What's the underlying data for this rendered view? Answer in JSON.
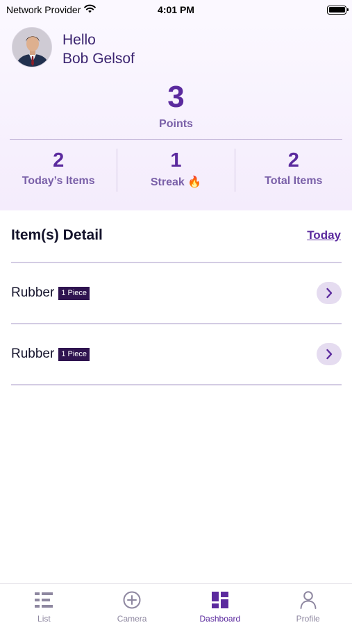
{
  "status_bar": {
    "carrier": "Network Provider",
    "time": "4:01 PM"
  },
  "header": {
    "greeting": "Hello",
    "user_name": "Bob Gelsof",
    "points_value": "3",
    "points_label": "Points",
    "stats": [
      {
        "value": "2",
        "label": "Today’s Items"
      },
      {
        "value": "1",
        "label": "Streak 🔥"
      },
      {
        "value": "2",
        "label": "Total Items"
      }
    ]
  },
  "detail": {
    "title": "Item(s) Detail",
    "filter_link": "Today",
    "items": [
      {
        "name": "Rubber",
        "badge": "1 Piece"
      },
      {
        "name": "Rubber",
        "badge": "1 Piece"
      }
    ]
  },
  "tab_bar": {
    "tabs": [
      {
        "label": "List",
        "icon": "list-icon"
      },
      {
        "label": "Camera",
        "icon": "add-circle-icon"
      },
      {
        "label": "Dashboard",
        "icon": "dashboard-icon"
      },
      {
        "label": "Profile",
        "icon": "person-icon"
      }
    ],
    "active_tab": "Dashboard"
  },
  "colors": {
    "accent": "#5b2a9e",
    "badge_bg": "#2f1450",
    "header_bg": "#f4ecfc",
    "inactive": "#8e87a0"
  }
}
